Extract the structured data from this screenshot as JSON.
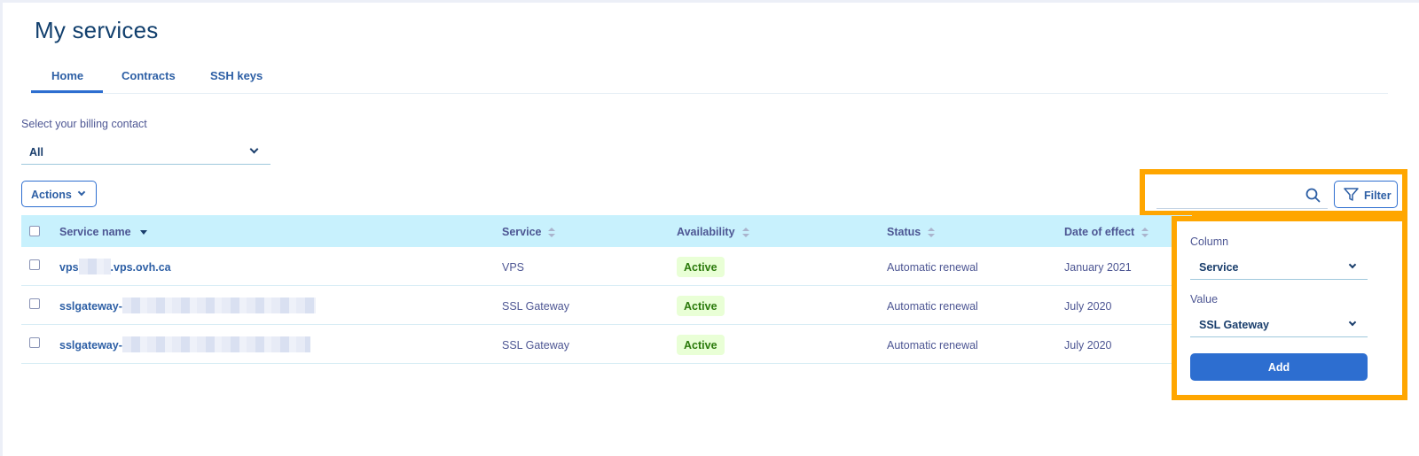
{
  "page": {
    "title": "My services"
  },
  "tabs": [
    {
      "label": "Home",
      "active": true
    },
    {
      "label": "Contracts",
      "active": false
    },
    {
      "label": "SSH keys",
      "active": false
    }
  ],
  "billing": {
    "label": "Select your billing contact",
    "value": "All"
  },
  "toolbar": {
    "actions_label": "Actions",
    "search_placeholder": "",
    "filter_label": "Filter"
  },
  "table": {
    "columns": [
      {
        "label": "Service name",
        "sort": "desc"
      },
      {
        "label": "Service",
        "sort": "none"
      },
      {
        "label": "Availability",
        "sort": "none"
      },
      {
        "label": "Status",
        "sort": "none"
      },
      {
        "label": "Date of effect",
        "sort": "none"
      }
    ],
    "rows": [
      {
        "name_prefix": "vps",
        "name_suffix": ".vps.ovh.ca",
        "service": "VPS",
        "availability": "Active",
        "status": "Automatic renewal",
        "date": "January 2021"
      },
      {
        "name_prefix": "sslgateway-",
        "name_suffix": "",
        "service": "SSL Gateway",
        "availability": "Active",
        "status": "Automatic renewal",
        "date": "July 2020"
      },
      {
        "name_prefix": "sslgateway-",
        "name_suffix": "",
        "service": "SSL Gateway",
        "availability": "Active",
        "status": "Automatic renewal",
        "date": "July 2020"
      }
    ]
  },
  "filter_panel": {
    "column_label": "Column",
    "column_value": "Service",
    "value_label": "Value",
    "value_value": "SSL Gateway",
    "add_label": "Add"
  },
  "colors": {
    "accent": "#2d6ed0",
    "highlight": "#ffa600",
    "header_bg": "#c8f1fd",
    "badge_bg": "#e9ffd6"
  }
}
